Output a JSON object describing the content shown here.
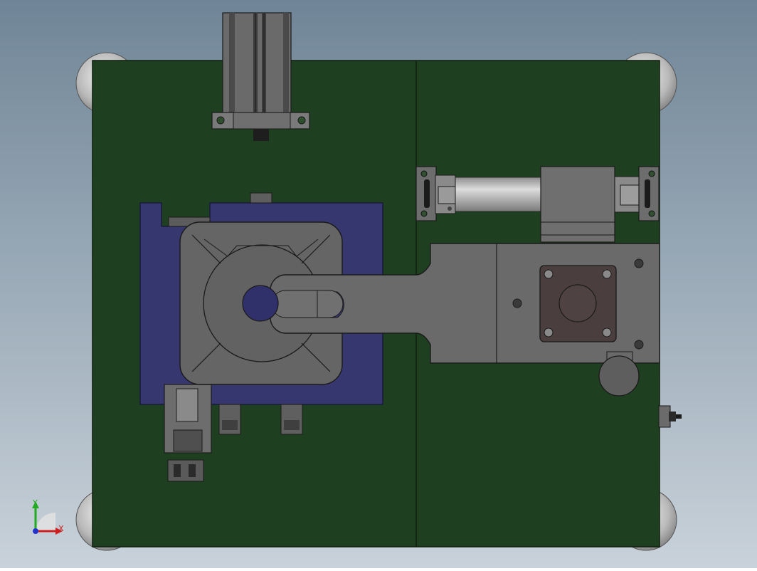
{
  "view": {
    "type": "CAD model top view",
    "background": {
      "top": "#6f8597",
      "bottom": "#c9d2da"
    }
  },
  "colors": {
    "base_plate": "#1f4020",
    "base_plate_edge": "#0e1e0e",
    "fixture_blue": "#36376f",
    "metal_gray": "#6e6e6e",
    "metal_dark": "#4a4a4a",
    "metal_light": "#a8a8a8",
    "hole_blue": "#30306a",
    "edge": "#1a1a1a",
    "axis_x": "#cc1f1f",
    "axis_y": "#22aa22",
    "axis_z": "#2233cc"
  },
  "triad": {
    "x_label": "X",
    "y_label": "Y",
    "icon": "coordinate-triad-icon"
  }
}
